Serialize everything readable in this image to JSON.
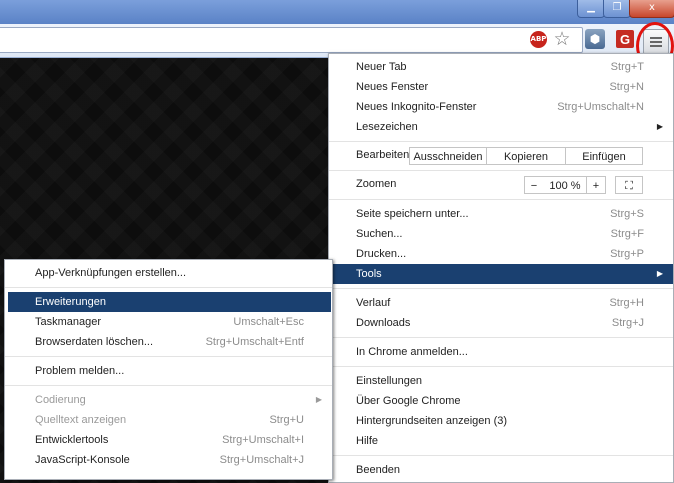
{
  "window": {
    "minimize_glyph": "▁",
    "maximize_glyph": "❐",
    "close_glyph": "x"
  },
  "toolbar": {
    "abp_label": "ABP",
    "star_glyph": "☆",
    "ext_glyph": "⬢",
    "g_label": "G"
  },
  "menu": {
    "new_tab": {
      "label": "Neuer Tab",
      "shortcut": "Strg+T"
    },
    "new_window": {
      "label": "Neues Fenster",
      "shortcut": "Strg+N"
    },
    "incognito": {
      "label": "Neues Inkognito-Fenster",
      "shortcut": "Strg+Umschalt+N"
    },
    "bookmarks": {
      "label": "Lesezeichen"
    },
    "edit": {
      "label": "Bearbeiten",
      "cut": "Ausschneiden",
      "copy": "Kopieren",
      "paste": "Einfügen"
    },
    "zoom": {
      "label": "Zoomen",
      "minus": "−",
      "value": "100 %",
      "plus": "+",
      "fullscreen_glyph": "⛶"
    },
    "save_page": {
      "label": "Seite speichern unter...",
      "shortcut": "Strg+S"
    },
    "find": {
      "label": "Suchen...",
      "shortcut": "Strg+F"
    },
    "print": {
      "label": "Drucken...",
      "shortcut": "Strg+P"
    },
    "tools": {
      "label": "Tools"
    },
    "history": {
      "label": "Verlauf",
      "shortcut": "Strg+H"
    },
    "downloads": {
      "label": "Downloads",
      "shortcut": "Strg+J"
    },
    "signin": {
      "label": "In Chrome anmelden..."
    },
    "settings": {
      "label": "Einstellungen"
    },
    "about": {
      "label": "Über Google Chrome"
    },
    "background_pages": {
      "label": "Hintergrundseiten anzeigen (3)"
    },
    "help": {
      "label": "Hilfe"
    },
    "exit": {
      "label": "Beenden"
    },
    "arrow_glyph": "▶"
  },
  "tools_menu": {
    "app_shortcuts": {
      "label": "App-Verknüpfungen erstellen..."
    },
    "extensions": {
      "label": "Erweiterungen"
    },
    "task_manager": {
      "label": "Taskmanager",
      "shortcut": "Umschalt+Esc"
    },
    "clear_data": {
      "label": "Browserdaten löschen...",
      "shortcut": "Strg+Umschalt+Entf"
    },
    "report_issue": {
      "label": "Problem melden..."
    },
    "encoding": {
      "label": "Codierung"
    },
    "view_source": {
      "label": "Quelltext anzeigen",
      "shortcut": "Strg+U"
    },
    "dev_tools": {
      "label": "Entwicklertools",
      "shortcut": "Strg+Umschalt+I"
    },
    "js_console": {
      "label": "JavaScript-Konsole",
      "shortcut": "Strg+Umschalt+J"
    }
  }
}
